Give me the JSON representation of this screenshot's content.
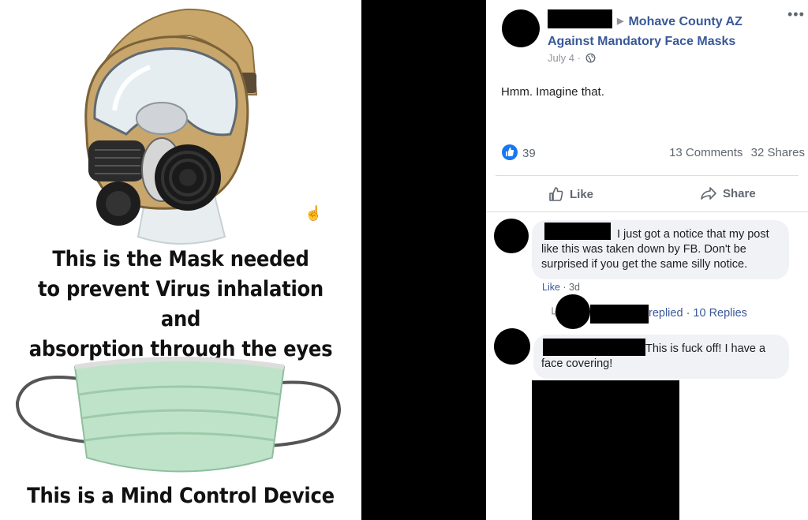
{
  "meme": {
    "caption_top": [
      "This is the Mask needed",
      "to prevent Virus inhalation and",
      "absorption through the eyes"
    ],
    "caption_bottom": "This is a Mind Control Device"
  },
  "post": {
    "group_name": "Mohave County AZ Against Mandatory Face Masks",
    "date": "July 4 ·",
    "privacy_icon": "globe-icon",
    "text": "Hmm. Imagine that.",
    "reaction_count": "39",
    "comments": "13 Comments",
    "shares": "32 Shares",
    "like_label": "Like",
    "share_label": "Share"
  },
  "comments": [
    {
      "text": "I just got a notice that my post like this was taken down by FB. Don't be surprised if you get the same silly notice.",
      "like_label": "Like",
      "age": "· 3d",
      "reply_text": "replied",
      "replies_link": "· 10 Replies"
    },
    {
      "text": "This is fuck off! I have a face covering!"
    }
  ],
  "colors": {
    "link": "#385898",
    "meta": "#606770",
    "bubble": "#f0f2f5",
    "reaction": "#1877f2"
  }
}
